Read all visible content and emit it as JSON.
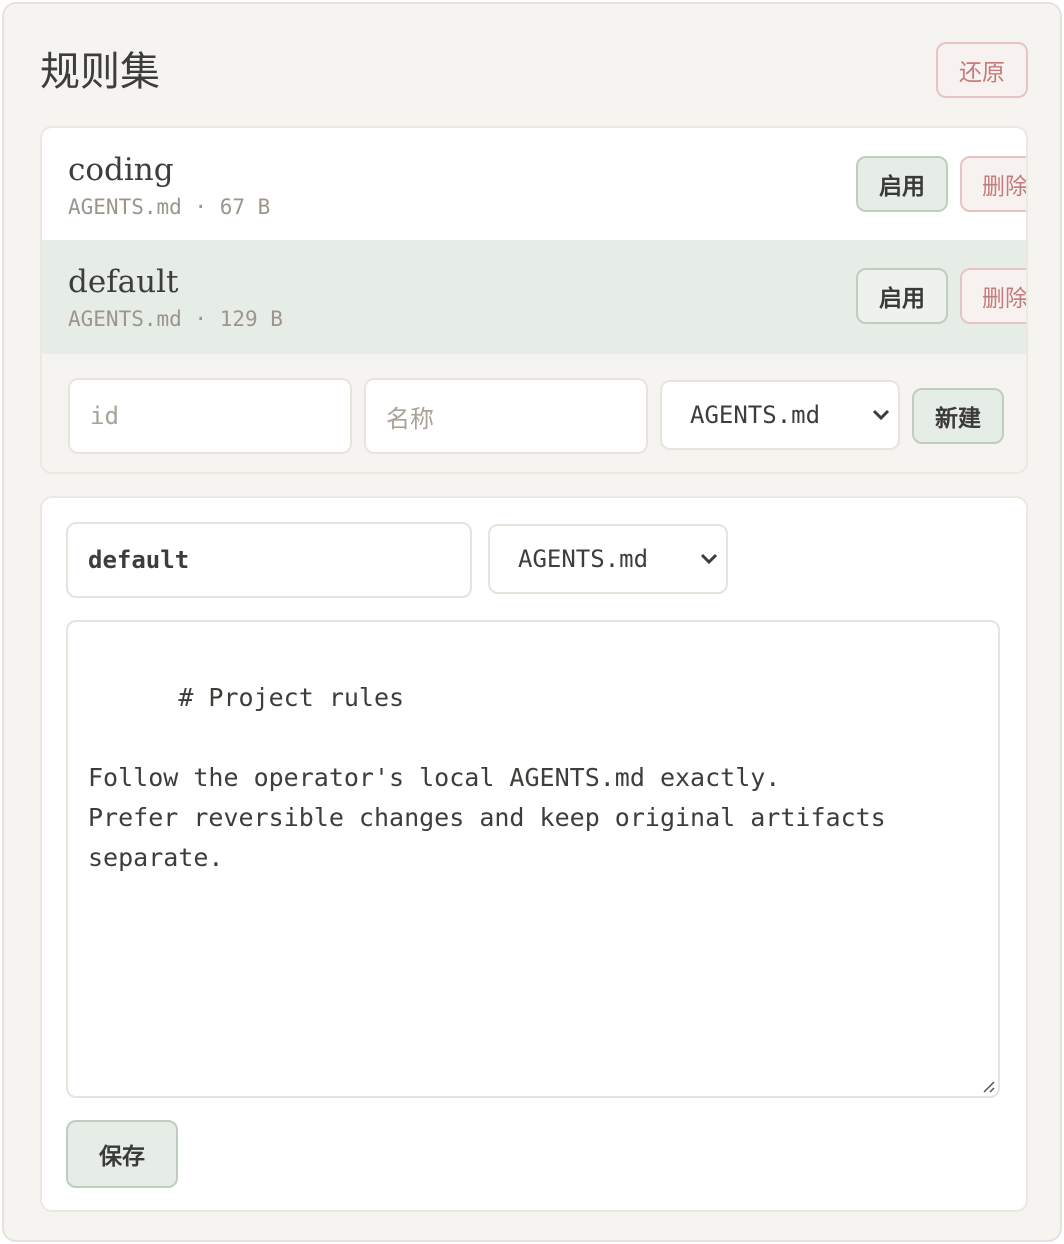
{
  "header": {
    "title": "规则集",
    "restore_label": "还原"
  },
  "rulesets": [
    {
      "name": "coding",
      "meta": "AGENTS.md · 67 B",
      "enable_label": "启用",
      "delete_label": "删除",
      "selected": false
    },
    {
      "name": "default",
      "meta": "AGENTS.md · 129 B",
      "enable_label": "启用",
      "delete_label": "删除",
      "selected": true
    }
  ],
  "new_form": {
    "id_placeholder": "id",
    "name_placeholder": "名称",
    "file_select_value": "AGENTS.md",
    "create_label": "新建"
  },
  "editor": {
    "id_value": "default",
    "file_select_value": "AGENTS.md",
    "content": "# Project rules\n\nFollow the operator's local AGENTS.md exactly.\nPrefer reversible changes and keep original artifacts separate.",
    "save_label": "保存"
  },
  "icons": {
    "select_chevron": "chevron-down-icon",
    "resize": "resize-handle-icon"
  },
  "colors": {
    "accent_green_bg": "#e6ede6",
    "danger_text": "#c47b7b",
    "panel_bg": "#f6f4f0"
  }
}
